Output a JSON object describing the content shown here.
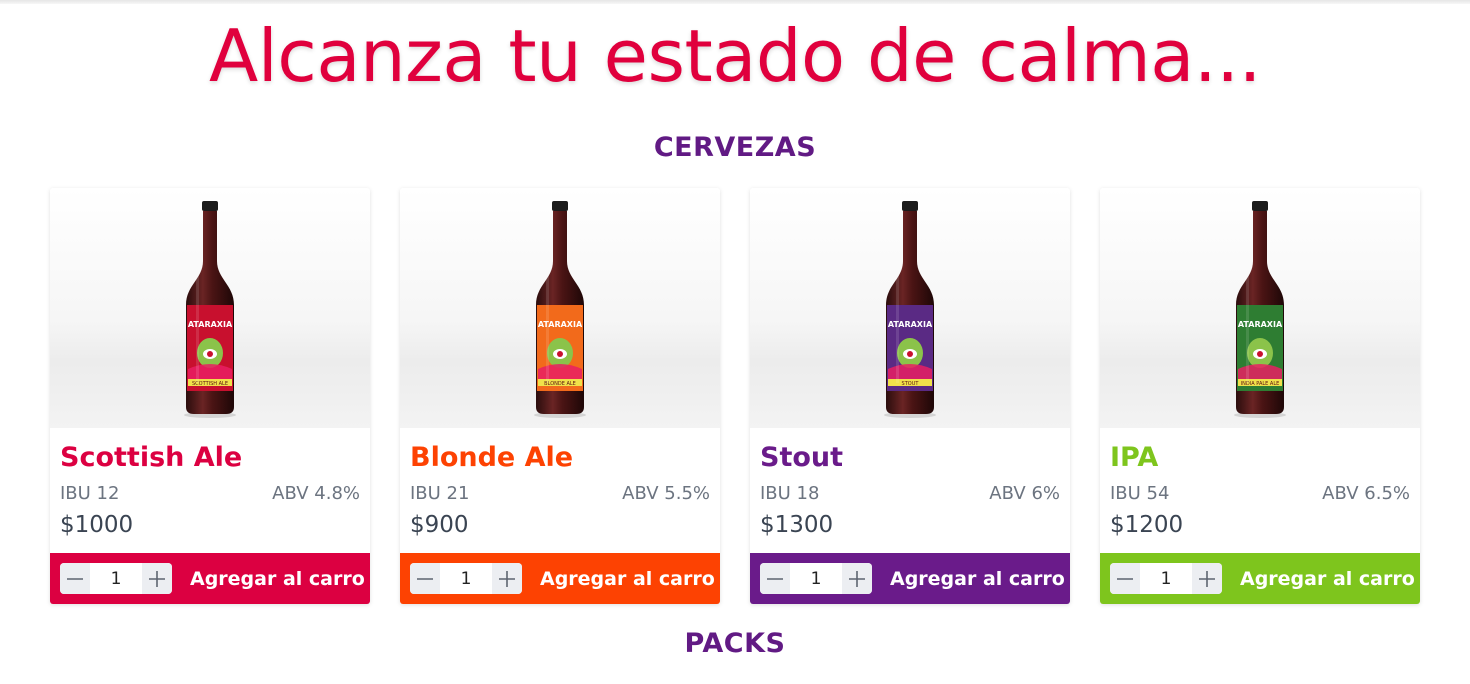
{
  "header": {
    "title": "Alcanza tu estado de calma..."
  },
  "sections": {
    "beers": "CERVEZAS",
    "packs": "PACKS"
  },
  "add_label": "Agregar al carro",
  "products": [
    {
      "name": "Scottish Ale",
      "ibu": "IBU 12",
      "abv": "ABV 4.8%",
      "price": "$1000",
      "qty": "1",
      "color": "#dc0041",
      "label_color": "#c8102e",
      "label_text": "SCOTTISH ALE",
      "brand": "ATARAXIA"
    },
    {
      "name": "Blonde Ale",
      "ibu": "IBU 21",
      "abv": "ABV 5.5%",
      "price": "$900",
      "qty": "1",
      "color": "#fd4202",
      "label_color": "#f26a1b",
      "label_text": "BLONDE ALE",
      "brand": "ATARAXIA"
    },
    {
      "name": "Stout",
      "ibu": "IBU 18",
      "abv": "ABV 6%",
      "price": "$1300",
      "qty": "1",
      "color": "#6a1b8a",
      "label_color": "#5a2a84",
      "label_text": "STOUT",
      "brand": "ATARAXIA"
    },
    {
      "name": "IPA",
      "ibu": "IBU 54",
      "abv": "ABV 6.5%",
      "price": "$1200",
      "qty": "1",
      "color": "#7ec51d",
      "label_color": "#2e7d32",
      "label_text": "INDIA PALE ALE",
      "brand": "ATARAXIA"
    }
  ],
  "icons": {
    "decrement": "minus-icon",
    "increment": "plus-icon"
  }
}
